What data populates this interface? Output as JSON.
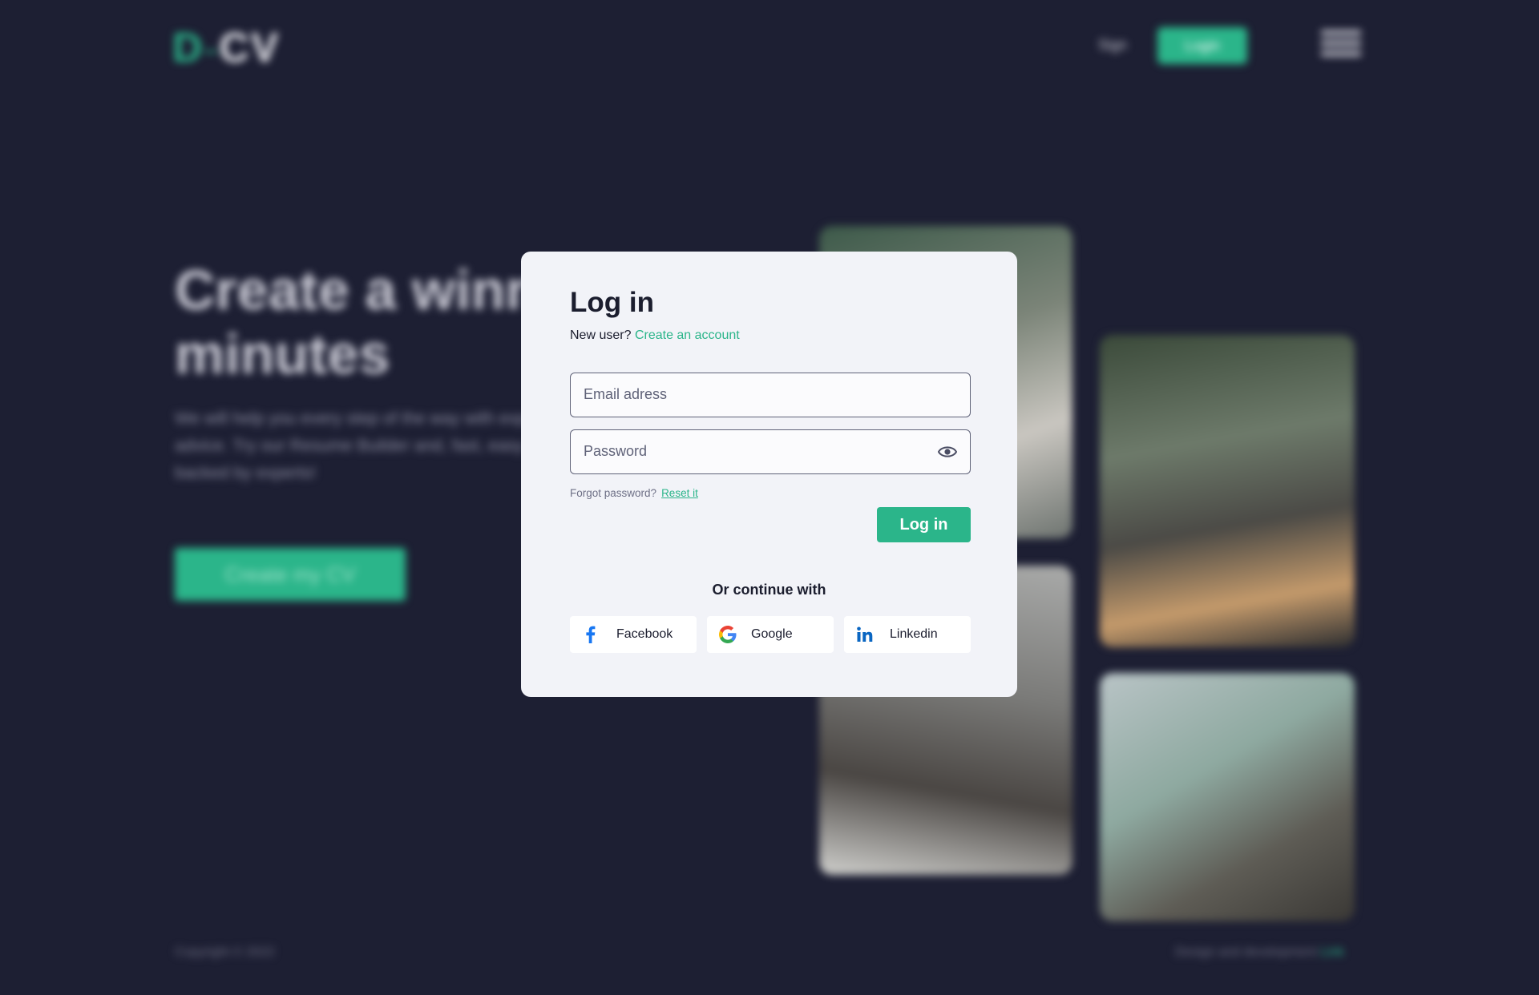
{
  "background": {
    "logo": {
      "d": "D",
      "dash": "–",
      "cv": "CV"
    },
    "nav": {
      "sign": "Sign",
      "login": "Login"
    },
    "hero": {
      "title": "Create a winning CV in minutes",
      "subtitle": "We will help you every step of the way with expert advice. Try our Resume Builder and, fast, easy and backed by experts!",
      "button": "Create my CV"
    },
    "footer": {
      "copyright": "Copyright © 2022",
      "design": "Design and development ",
      "design_link": "Link"
    }
  },
  "modal": {
    "title": "Log in",
    "new_user": "New user?",
    "create_account": "Create an account",
    "email_placeholder": "Email adress",
    "password_placeholder": "Password",
    "forgot": "Forgot password?",
    "reset": "Reset it",
    "login_button": "Log in",
    "or_continue": "Or continue with",
    "social": {
      "facebook": "Facebook",
      "google": "Google",
      "linkedin": "Linkedin"
    }
  },
  "colors": {
    "accent": "#2bb58a",
    "page_bg": "#1d1f33",
    "modal_bg": "#f2f3f8",
    "facebook": "#1877f2",
    "linkedin": "#0a66c2"
  },
  "icons": [
    "eye-icon",
    "facebook-icon",
    "google-icon",
    "linkedin-icon",
    "menu-icon"
  ]
}
